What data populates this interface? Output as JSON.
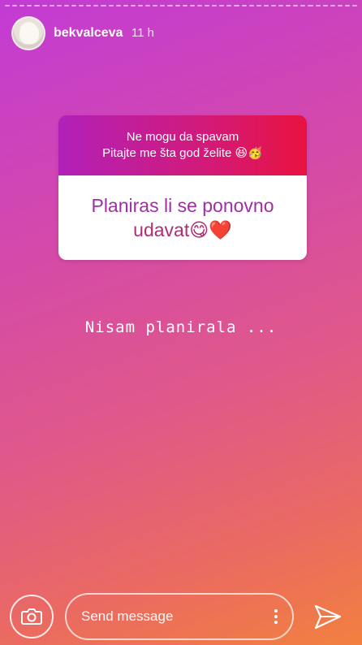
{
  "header": {
    "username": "bekvalceva",
    "time": "11 h"
  },
  "question_sticker": {
    "prompt_line1": "Ne mogu da spavam",
    "prompt_line2": "Pitajte me šta god želite 😆🥳",
    "question_line1": "Planiras li se ponovno",
    "question_line2": "udavat😋❤️"
  },
  "story_text": "Nisam planirala ...",
  "footer": {
    "message_placeholder": "Send message"
  },
  "icons": [
    "camera-icon",
    "more-vertical-icon",
    "send-icon"
  ]
}
